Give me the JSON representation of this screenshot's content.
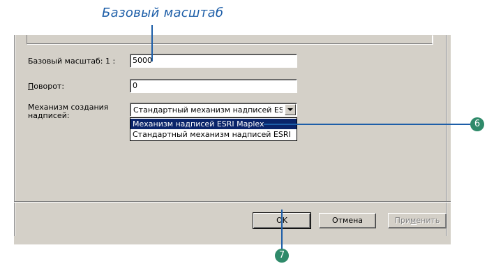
{
  "callout": {
    "title": "Базовый масштаб",
    "badge_6": "6",
    "badge_7": "7"
  },
  "form": {
    "scale_label": "Базовый масштаб:  1 :",
    "scale_value": "5000",
    "rotation_label_prefix": "П",
    "rotation_label_rest": "оворот:",
    "rotation_value": "0",
    "engine_label_line1": "Механизм создания",
    "engine_label_line2": "надписей:",
    "engine_selected": "Стандартный механизм надписей ESRI",
    "engine_options": [
      "Механизм надписей ESRI Maplex",
      "Стандартный механизм надписей ESRI"
    ]
  },
  "buttons": {
    "ok": "OK",
    "cancel": "Отмена",
    "apply_prefix": "При",
    "apply_mnemonic": "м",
    "apply_rest": "енить"
  },
  "colors": {
    "accent": "#1d5ea8",
    "badge": "#2f8a6a",
    "dialog_bg": "#d4d0c8",
    "highlight": "#0a246a"
  }
}
